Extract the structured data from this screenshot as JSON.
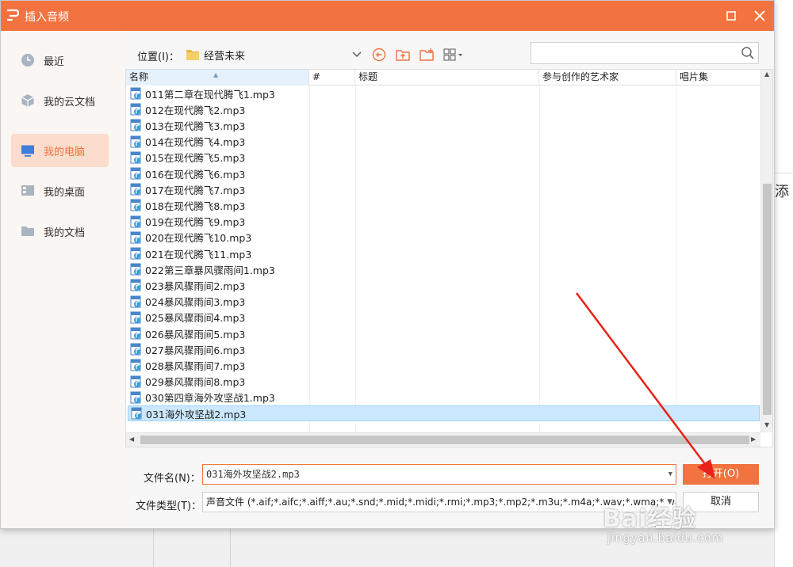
{
  "dialog": {
    "title": "插入音频",
    "colors": {
      "accent": "#f2733f",
      "selected_nav_bg": "#fbdccd",
      "selected_row_bg": "#cce8ff"
    }
  },
  "sidebar": {
    "items": [
      {
        "label": "最近",
        "icon": "clock-icon"
      },
      {
        "label": "我的云文档",
        "icon": "cloud-cube-icon"
      },
      {
        "label": "我的电脑",
        "icon": "monitor-icon",
        "active": true
      },
      {
        "label": "我的桌面",
        "icon": "desktop-icon"
      },
      {
        "label": "我的文档",
        "icon": "folder-icon"
      }
    ]
  },
  "toolbar": {
    "location_label": "位置(I)：",
    "location_value": "经营未来"
  },
  "columns": [
    "名称",
    "#",
    "标题",
    "参与创作的艺术家",
    "唱片集"
  ],
  "files": [
    "011第二章在现代腾飞1.mp3",
    "012在现代腾飞2.mp3",
    "013在现代腾飞3.mp3",
    "014在现代腾飞4.mp3",
    "015在现代腾飞5.mp3",
    "016在现代腾飞6.mp3",
    "017在现代腾飞7.mp3",
    "018在现代腾飞8.mp3",
    "019在现代腾飞9.mp3",
    "020在现代腾飞10.mp3",
    "021在现代腾飞11.mp3",
    "022第三章暴风骤雨间1.mp3",
    "023暴风骤雨间2.mp3",
    "024暴风骤雨间3.mp3",
    "025暴风骤雨间4.mp3",
    "026暴风骤雨间5.mp3",
    "027暴风骤雨间6.mp3",
    "028暴风骤雨间7.mp3",
    "029暴风骤雨间8.mp3",
    "030第四章海外攻坚战1.mp3",
    "031海外攻坚战2.mp3"
  ],
  "selected_file": "031海外攻坚战2.mp3",
  "footer": {
    "filename_label": "文件名(N)：",
    "filename_value": "031海外攻坚战2.mp3",
    "filetype_label": "文件类型(T)：",
    "filetype_value": "声音文件 (*.aif;*.aifc;*.aiff;*.au;*.snd;*.mid;*.midi;*.rmi;*.mp3;*.mp2;*.m3u;*.m4a;*.wav;*.wma;*.wax)",
    "open_label": "打开(O)",
    "cancel_label": "取消"
  },
  "background": {
    "right_glyph": "添"
  },
  "watermark": {
    "logo": "Bai经验",
    "url": "jingyan.baidu.com"
  }
}
